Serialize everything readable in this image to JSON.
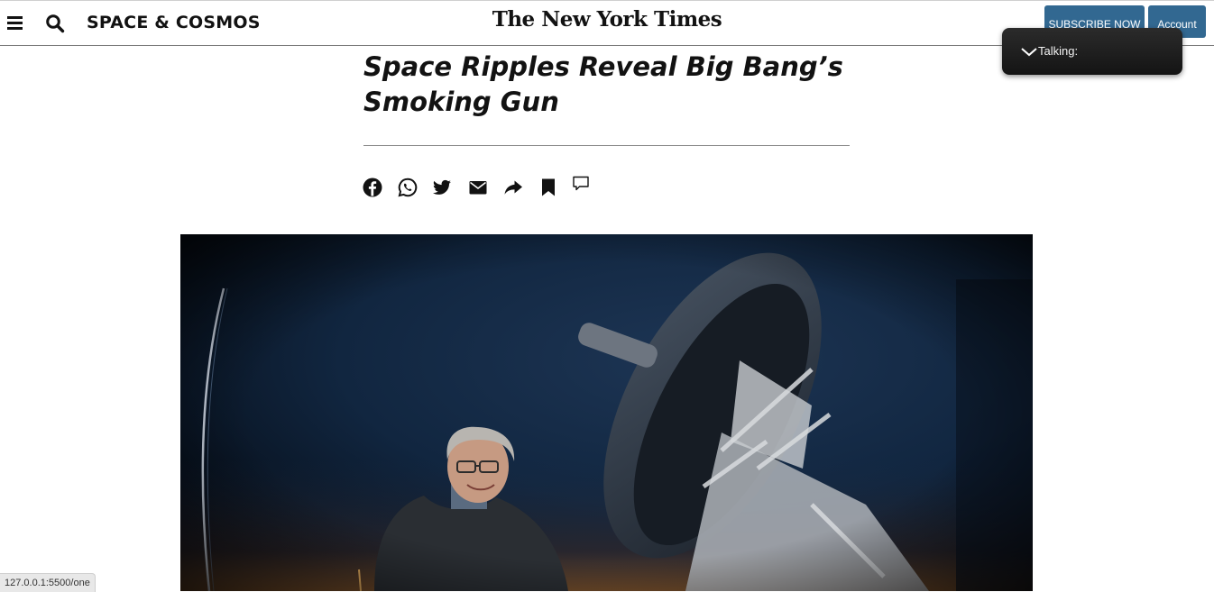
{
  "header": {
    "section_title": "SPACE & COSMOS",
    "masthead": "The New York Times",
    "subscribe_label": "SUBSCRIBE NOW",
    "account_label": "Account",
    "icons": {
      "menu": "hamburger-menu-icon",
      "search": "search-icon"
    }
  },
  "talking_panel": {
    "label": "Talking:",
    "icon": "chevron-down-icon"
  },
  "article": {
    "headline": "Space Ripples Reveal Big Bang’s Smoking Gun",
    "share_icons": [
      "facebook-icon",
      "whatsapp-icon",
      "twitter-icon",
      "email-icon",
      "share-icon",
      "bookmark-icon",
      "comment-icon"
    ]
  },
  "status_bar": {
    "url": "127.0.0.1:5500/one"
  },
  "colors": {
    "brand_button": "#326891",
    "text": "#121212",
    "panel_bg": "#1e1e1e"
  }
}
